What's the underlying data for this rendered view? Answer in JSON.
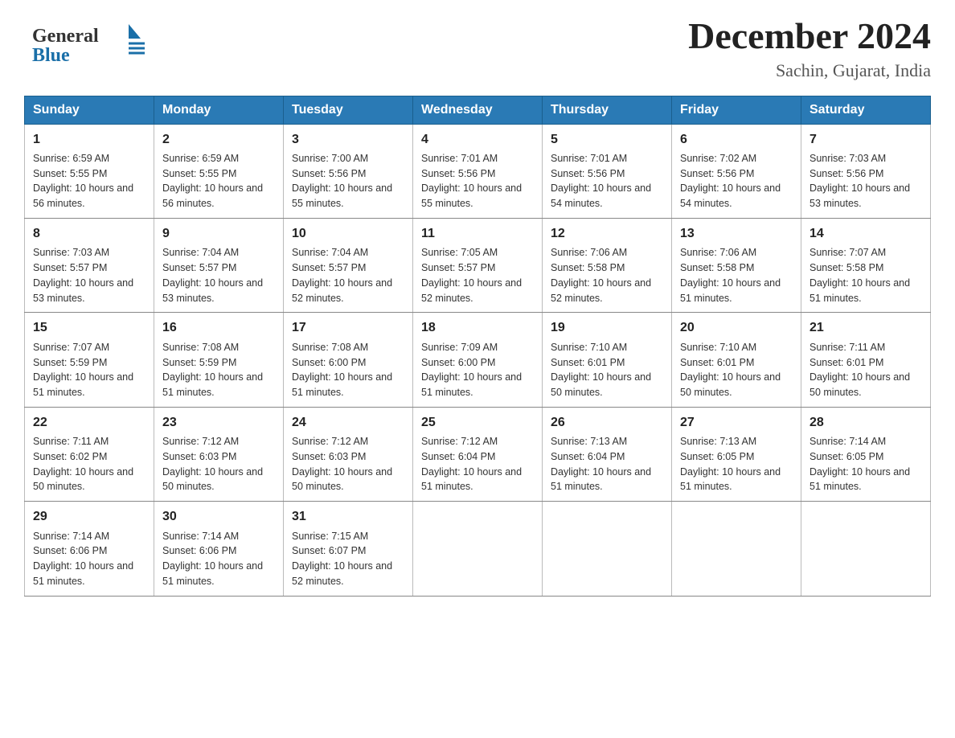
{
  "logo": {
    "text_general": "General",
    "text_blue": "Blue",
    "lines": 3
  },
  "title": "December 2024",
  "subtitle": "Sachin, Gujarat, India",
  "days_of_week": [
    "Sunday",
    "Monday",
    "Tuesday",
    "Wednesday",
    "Thursday",
    "Friday",
    "Saturday"
  ],
  "weeks": [
    [
      {
        "day": "1",
        "sunrise": "6:59 AM",
        "sunset": "5:55 PM",
        "daylight": "10 hours and 56 minutes."
      },
      {
        "day": "2",
        "sunrise": "6:59 AM",
        "sunset": "5:55 PM",
        "daylight": "10 hours and 56 minutes."
      },
      {
        "day": "3",
        "sunrise": "7:00 AM",
        "sunset": "5:56 PM",
        "daylight": "10 hours and 55 minutes."
      },
      {
        "day": "4",
        "sunrise": "7:01 AM",
        "sunset": "5:56 PM",
        "daylight": "10 hours and 55 minutes."
      },
      {
        "day": "5",
        "sunrise": "7:01 AM",
        "sunset": "5:56 PM",
        "daylight": "10 hours and 54 minutes."
      },
      {
        "day": "6",
        "sunrise": "7:02 AM",
        "sunset": "5:56 PM",
        "daylight": "10 hours and 54 minutes."
      },
      {
        "day": "7",
        "sunrise": "7:03 AM",
        "sunset": "5:56 PM",
        "daylight": "10 hours and 53 minutes."
      }
    ],
    [
      {
        "day": "8",
        "sunrise": "7:03 AM",
        "sunset": "5:57 PM",
        "daylight": "10 hours and 53 minutes."
      },
      {
        "day": "9",
        "sunrise": "7:04 AM",
        "sunset": "5:57 PM",
        "daylight": "10 hours and 53 minutes."
      },
      {
        "day": "10",
        "sunrise": "7:04 AM",
        "sunset": "5:57 PM",
        "daylight": "10 hours and 52 minutes."
      },
      {
        "day": "11",
        "sunrise": "7:05 AM",
        "sunset": "5:57 PM",
        "daylight": "10 hours and 52 minutes."
      },
      {
        "day": "12",
        "sunrise": "7:06 AM",
        "sunset": "5:58 PM",
        "daylight": "10 hours and 52 minutes."
      },
      {
        "day": "13",
        "sunrise": "7:06 AM",
        "sunset": "5:58 PM",
        "daylight": "10 hours and 51 minutes."
      },
      {
        "day": "14",
        "sunrise": "7:07 AM",
        "sunset": "5:58 PM",
        "daylight": "10 hours and 51 minutes."
      }
    ],
    [
      {
        "day": "15",
        "sunrise": "7:07 AM",
        "sunset": "5:59 PM",
        "daylight": "10 hours and 51 minutes."
      },
      {
        "day": "16",
        "sunrise": "7:08 AM",
        "sunset": "5:59 PM",
        "daylight": "10 hours and 51 minutes."
      },
      {
        "day": "17",
        "sunrise": "7:08 AM",
        "sunset": "6:00 PM",
        "daylight": "10 hours and 51 minutes."
      },
      {
        "day": "18",
        "sunrise": "7:09 AM",
        "sunset": "6:00 PM",
        "daylight": "10 hours and 51 minutes."
      },
      {
        "day": "19",
        "sunrise": "7:10 AM",
        "sunset": "6:01 PM",
        "daylight": "10 hours and 50 minutes."
      },
      {
        "day": "20",
        "sunrise": "7:10 AM",
        "sunset": "6:01 PM",
        "daylight": "10 hours and 50 minutes."
      },
      {
        "day": "21",
        "sunrise": "7:11 AM",
        "sunset": "6:01 PM",
        "daylight": "10 hours and 50 minutes."
      }
    ],
    [
      {
        "day": "22",
        "sunrise": "7:11 AM",
        "sunset": "6:02 PM",
        "daylight": "10 hours and 50 minutes."
      },
      {
        "day": "23",
        "sunrise": "7:12 AM",
        "sunset": "6:03 PM",
        "daylight": "10 hours and 50 minutes."
      },
      {
        "day": "24",
        "sunrise": "7:12 AM",
        "sunset": "6:03 PM",
        "daylight": "10 hours and 50 minutes."
      },
      {
        "day": "25",
        "sunrise": "7:12 AM",
        "sunset": "6:04 PM",
        "daylight": "10 hours and 51 minutes."
      },
      {
        "day": "26",
        "sunrise": "7:13 AM",
        "sunset": "6:04 PM",
        "daylight": "10 hours and 51 minutes."
      },
      {
        "day": "27",
        "sunrise": "7:13 AM",
        "sunset": "6:05 PM",
        "daylight": "10 hours and 51 minutes."
      },
      {
        "day": "28",
        "sunrise": "7:14 AM",
        "sunset": "6:05 PM",
        "daylight": "10 hours and 51 minutes."
      }
    ],
    [
      {
        "day": "29",
        "sunrise": "7:14 AM",
        "sunset": "6:06 PM",
        "daylight": "10 hours and 51 minutes."
      },
      {
        "day": "30",
        "sunrise": "7:14 AM",
        "sunset": "6:06 PM",
        "daylight": "10 hours and 51 minutes."
      },
      {
        "day": "31",
        "sunrise": "7:15 AM",
        "sunset": "6:07 PM",
        "daylight": "10 hours and 52 minutes."
      },
      null,
      null,
      null,
      null
    ]
  ]
}
